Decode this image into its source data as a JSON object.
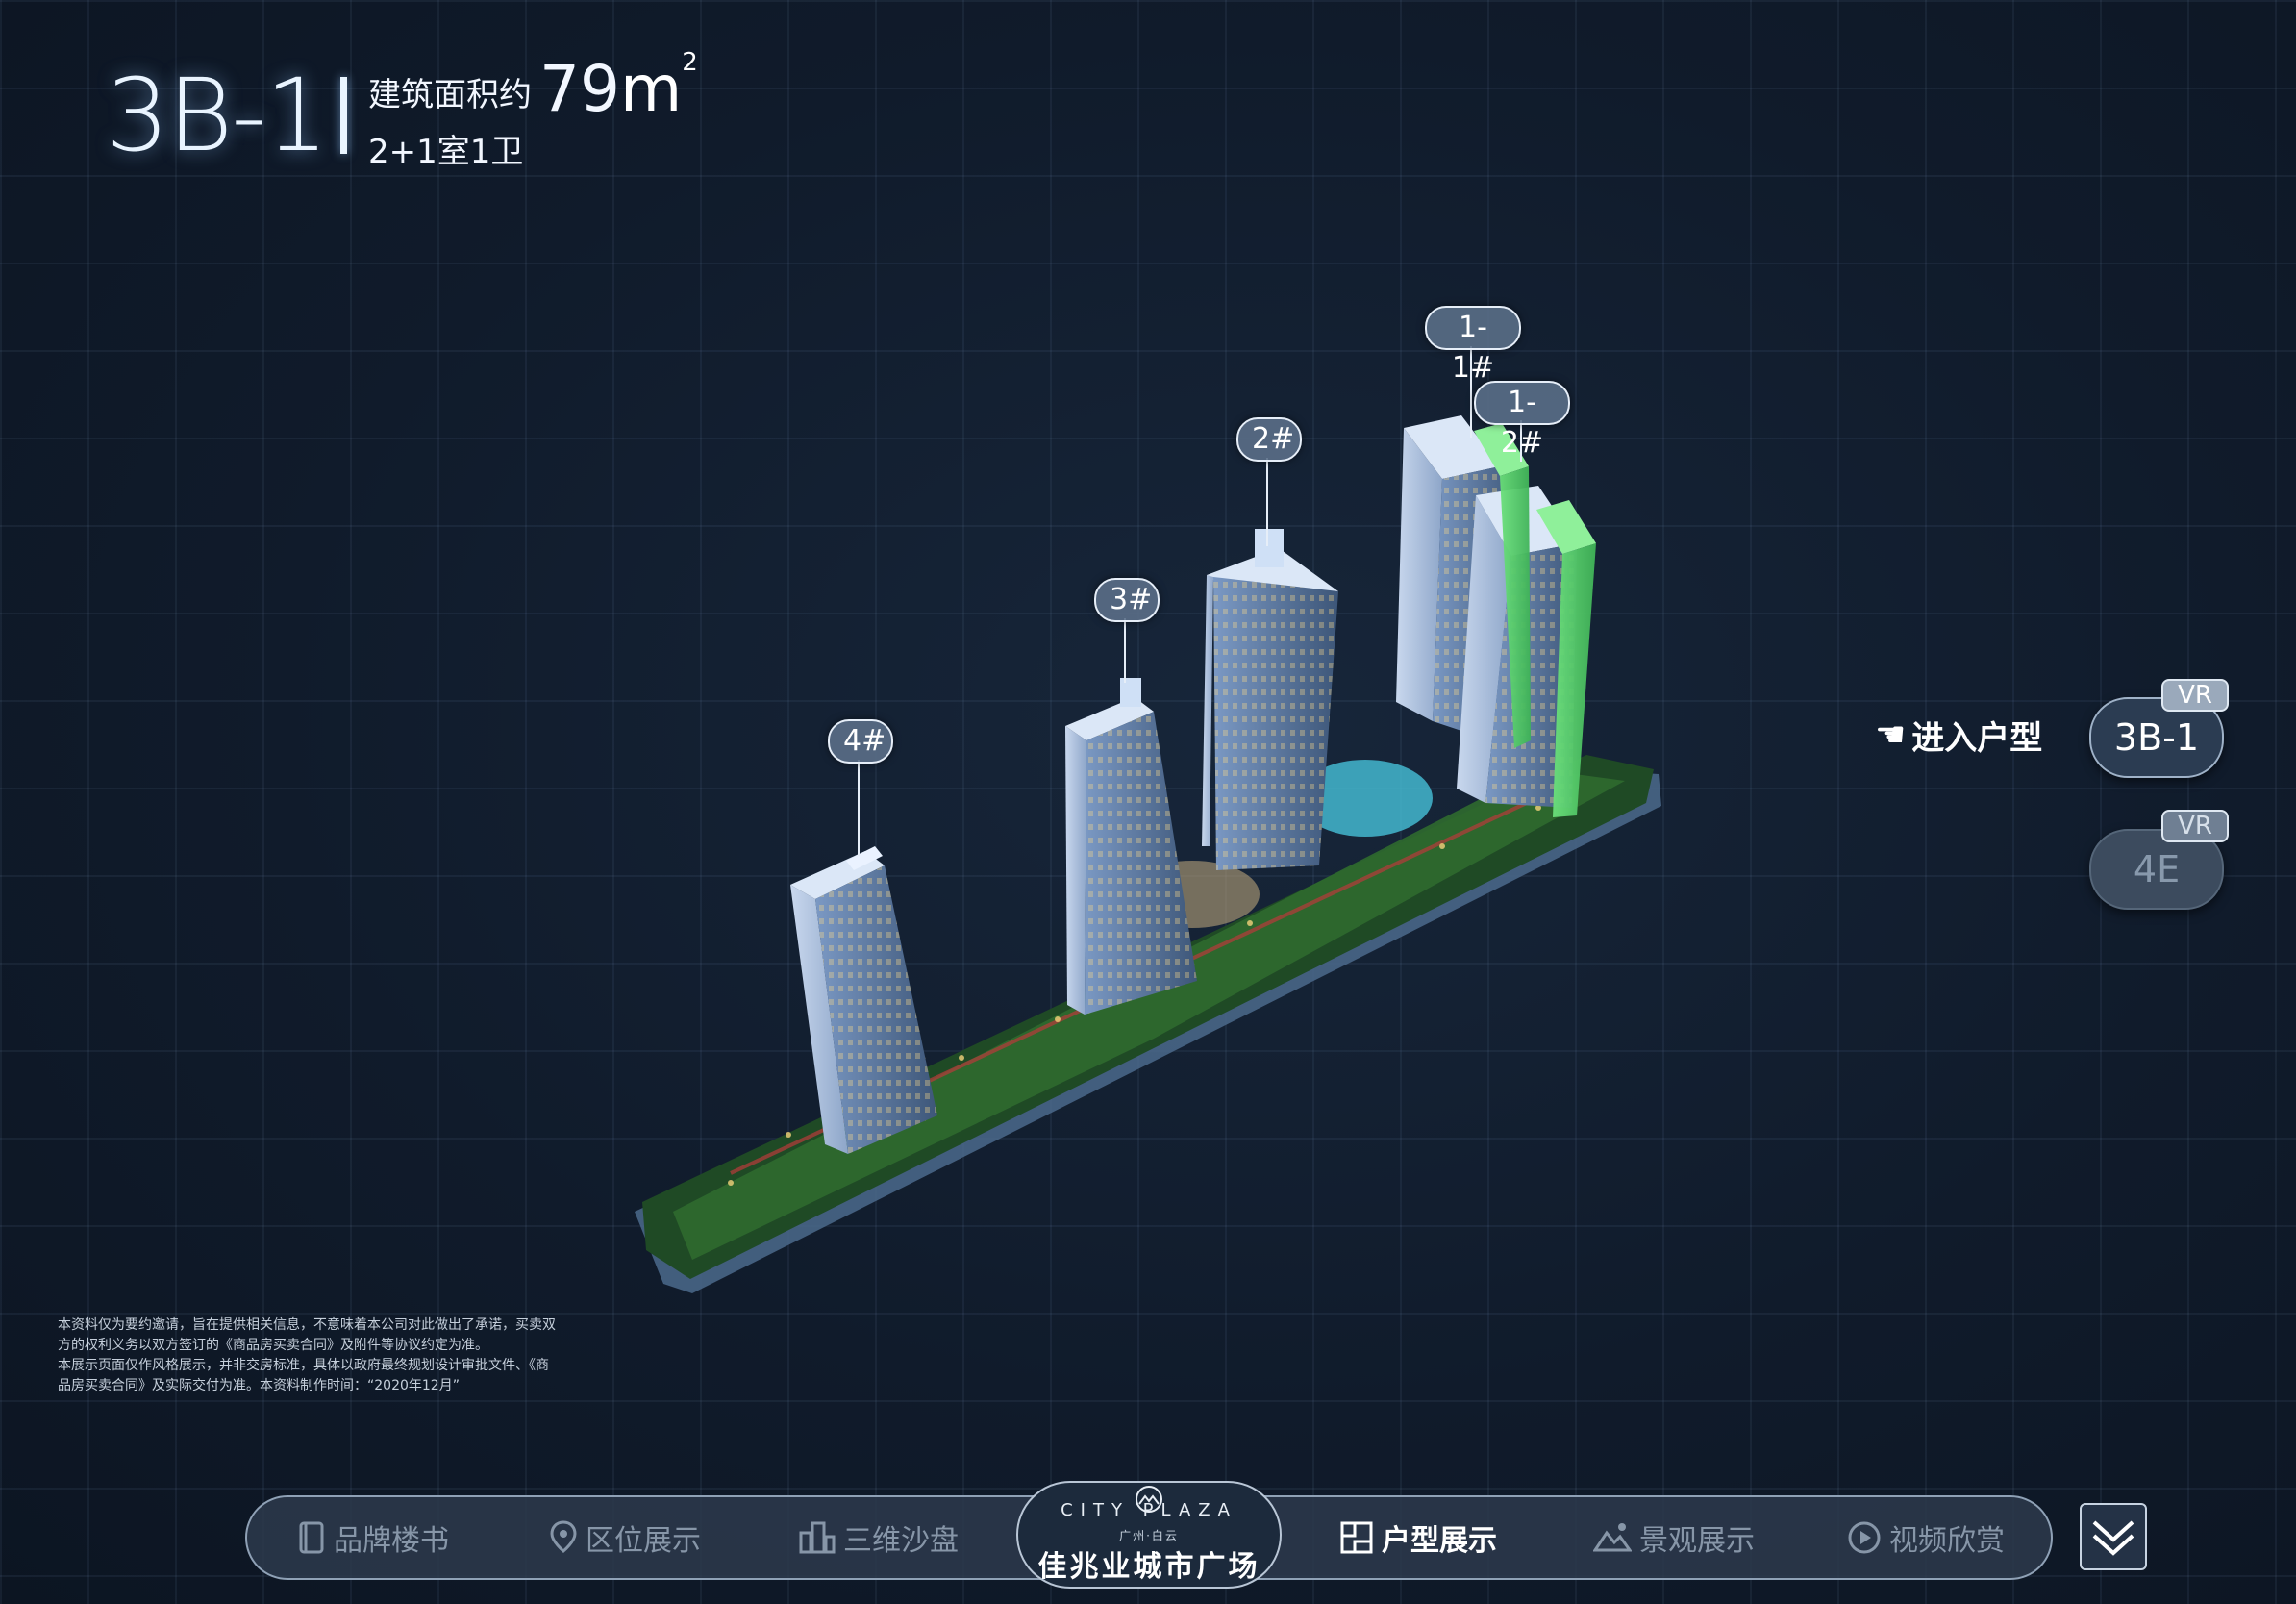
{
  "header": {
    "unit_code": "3B-1",
    "area_label": "建筑面积约",
    "area_value": "79",
    "area_unit": "m",
    "area_sup": "2",
    "rooms": "2+1室1卫"
  },
  "building_tags": [
    "1-1#",
    "1-2#",
    "2#",
    "3#",
    "4#"
  ],
  "side_panel": {
    "enter_label": "进入户型",
    "units": [
      {
        "label": "3B-1",
        "badge": "VR",
        "active": true
      },
      {
        "label": "4E",
        "badge": "VR",
        "active": false
      }
    ]
  },
  "disclaimer": [
    "本资料仅为要约邀请，旨在提供相关信息，不意味着本公司对此做出了承诺，买卖双",
    "方的权利义务以双方签订的《商品房买卖合同》及附件等协议约定为准。",
    "本展示页面仅作风格展示，并非交房标准，具体以政府最终规划设计审批文件、《商",
    "品房买卖合同》及实际交付为准。本资料制作时间：“2020年12月”"
  ],
  "nav": {
    "items": [
      {
        "label": "品牌楼书",
        "icon": "book-icon"
      },
      {
        "label": "区位展示",
        "icon": "location-pin-icon"
      },
      {
        "label": "三维沙盘",
        "icon": "buildings-icon"
      },
      {
        "label": "户型展示",
        "icon": "floorplan-icon",
        "active": true
      },
      {
        "label": "景观展示",
        "icon": "landscape-icon"
      },
      {
        "label": "视频欣赏",
        "icon": "play-icon"
      }
    ],
    "logo_top": "CITY PLAZA",
    "logo_sub": "广州·白云",
    "logo_main": "佳兆业城市广场"
  },
  "colors": {
    "background": "#0f1a2a",
    "highlight_building": "#4fd36a",
    "nav_active": "#ffffff",
    "nav_inactive": "#8796a8"
  }
}
